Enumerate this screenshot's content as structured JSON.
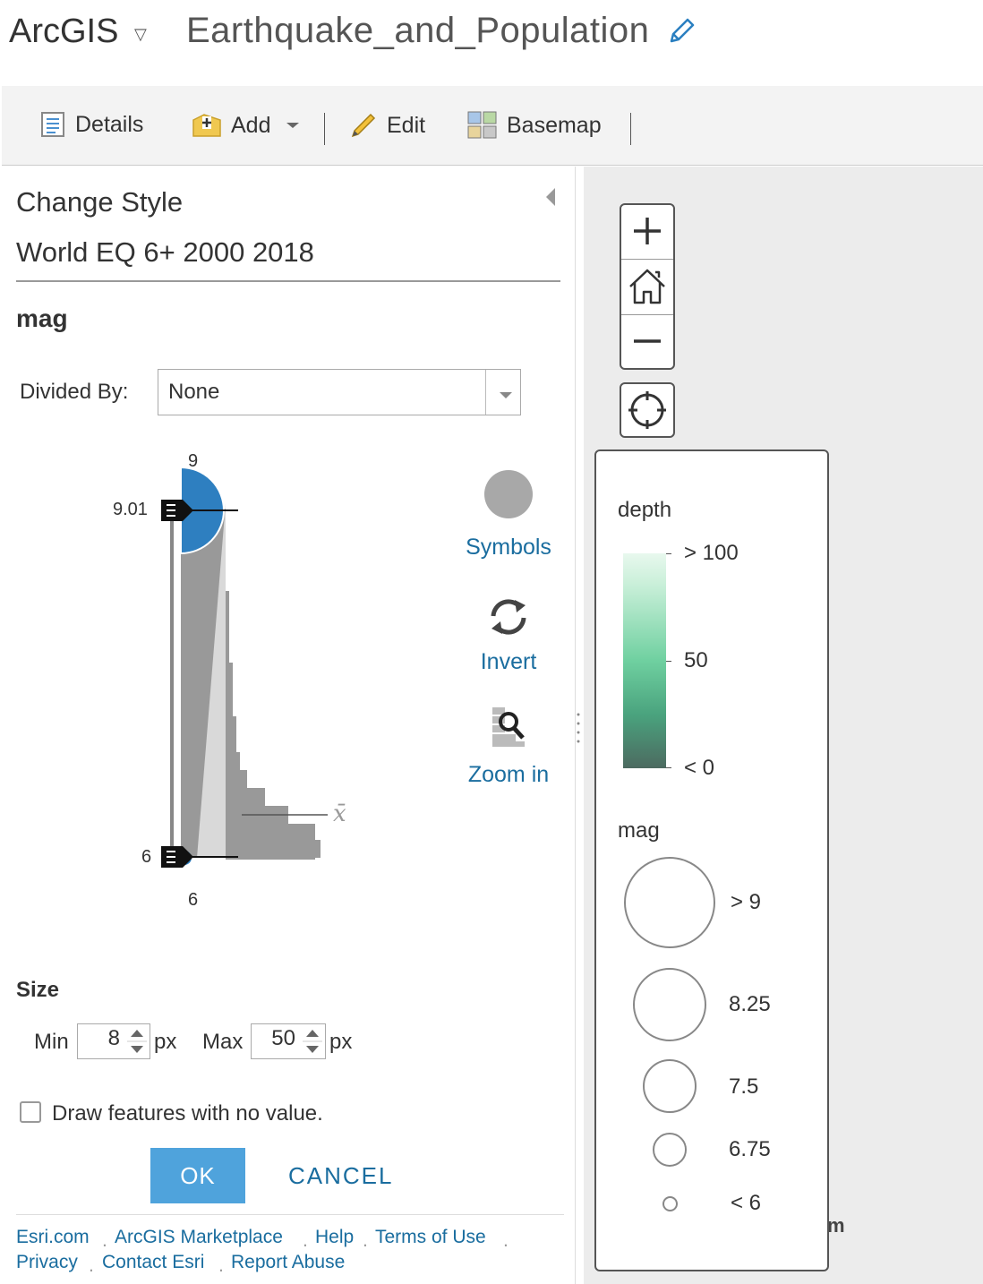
{
  "header": {
    "brand": "ArcGIS",
    "map_title": "Earthquake_and_Population"
  },
  "toolbar": {
    "details": "Details",
    "add": "Add",
    "edit": "Edit",
    "basemap": "Basemap"
  },
  "panel": {
    "title": "Change Style",
    "layer_name": "World EQ 6+ 2000 2018",
    "field": "mag",
    "divided_by_label": "Divided By:",
    "divided_by_value": "None",
    "histogram": {
      "top_label": "9",
      "bottom_label": "6",
      "handle_top_value": "9.01",
      "handle_bottom_value": "6",
      "mean_symbol": "x̄"
    },
    "tools": {
      "symbols": "Symbols",
      "invert": "Invert",
      "zoom_in": "Zoom in"
    },
    "size": {
      "title": "Size",
      "min_label": "Min",
      "min_value": "8",
      "max_label": "Max",
      "max_value": "50",
      "unit": "px"
    },
    "draw_no_value": "Draw features with no value.",
    "ok": "OK",
    "cancel": "CANCEL"
  },
  "footer": {
    "links": [
      "Esri.com",
      "ArcGIS Marketplace",
      "Help",
      "Terms of Use",
      "Privacy",
      "Contact Esri",
      "Report Abuse"
    ]
  },
  "legend": {
    "depth_title": "depth",
    "depth_labels": [
      "> 100",
      "50",
      "< 0"
    ],
    "mag_title": "mag",
    "mag_labels": [
      "> 9",
      "8.25",
      "7.5",
      "6.75",
      "< 6"
    ]
  },
  "map_fragment": "m",
  "colors": {
    "link": "#1a6d9f",
    "ok_button": "#4fa3dc",
    "symbol_blue": "#2e7fc0",
    "ramp_top": "#e8f8ee",
    "ramp_mid": "#6fd0a0",
    "ramp_bottom": "#4c6a60"
  },
  "icons": [
    "chevron-down-icon",
    "pencil-icon",
    "details-icon",
    "add-icon",
    "basemap-icon",
    "collapse-arrow-icon",
    "zoom-in-icon",
    "home-icon",
    "zoom-out-icon",
    "locate-icon",
    "symbol-circle-icon",
    "invert-icon",
    "magnifier-icon"
  ]
}
